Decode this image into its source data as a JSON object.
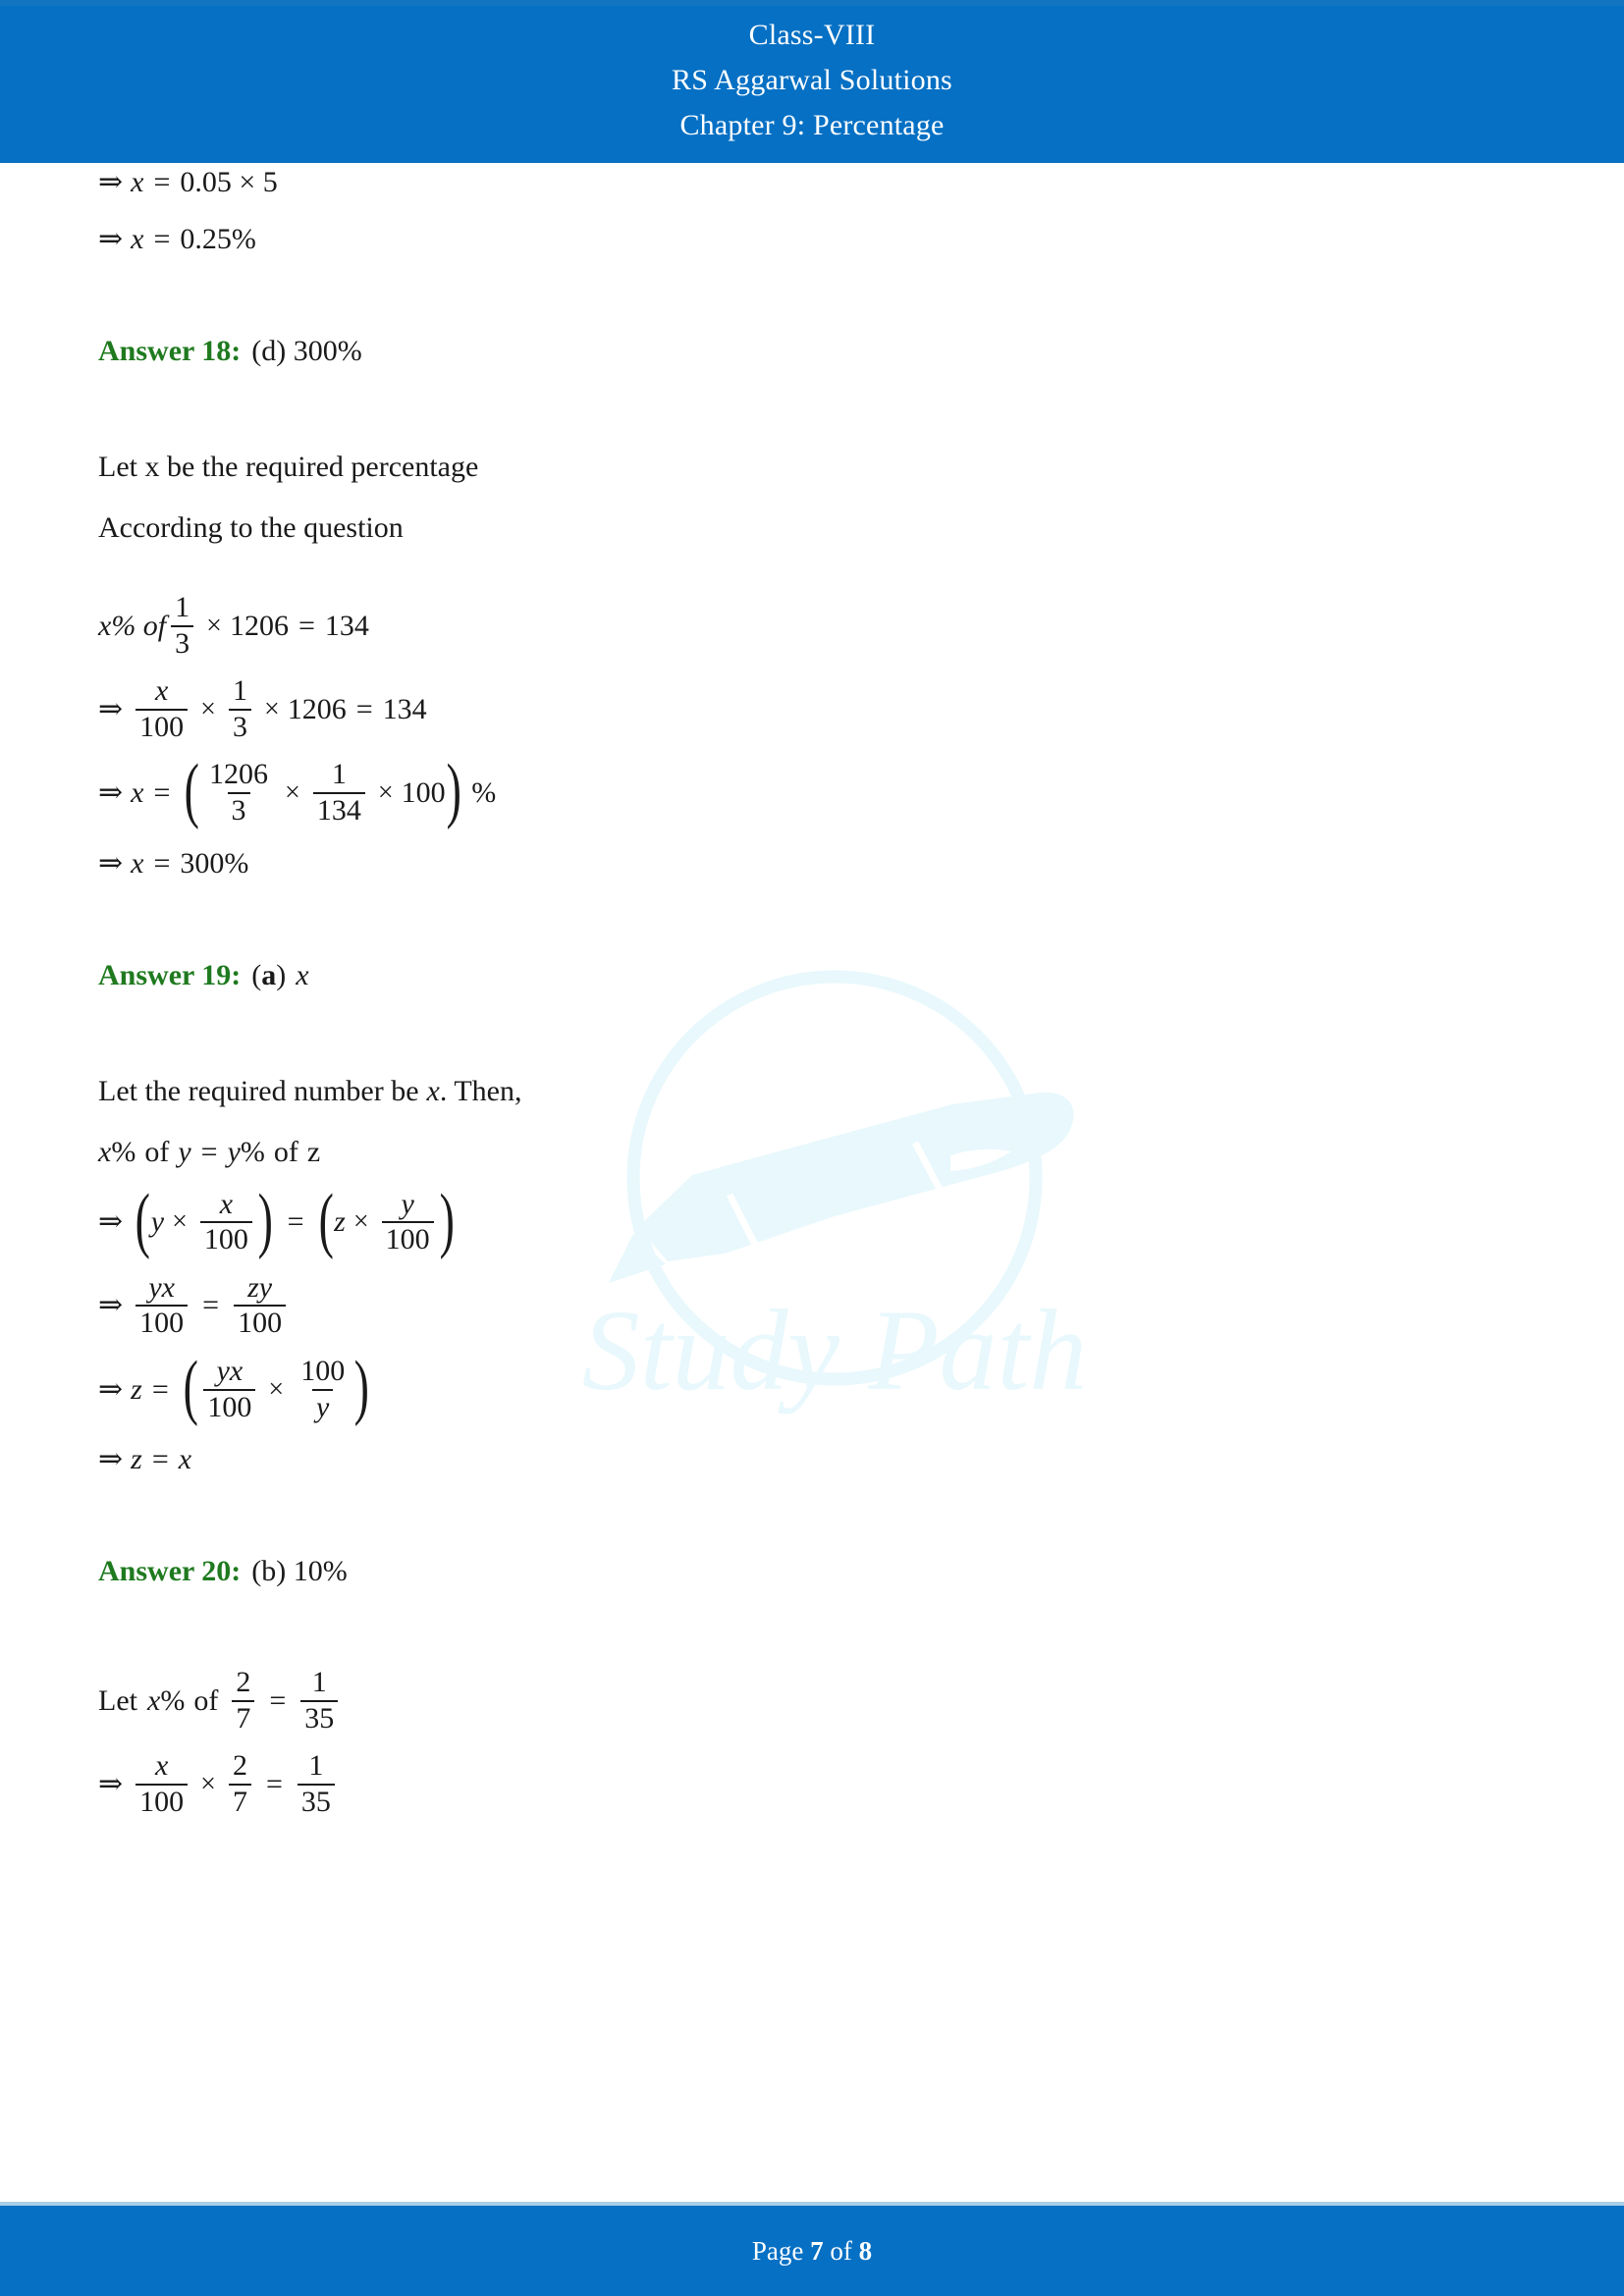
{
  "colors": {
    "header_blue": "#0570c4",
    "footer_blue": "#0570c4",
    "answer_green": "#1f7a1f",
    "text_black": "#1a1a1a",
    "watermark_cyan": "#e6f8fc"
  },
  "header": {
    "line1": "Class-VIII",
    "line2": "RS Aggarwal Solutions",
    "line3": "Chapter 9: Percentage"
  },
  "footer": {
    "prefix": "Page",
    "current_page": "7",
    "middle": "of",
    "total_pages": "8"
  },
  "watermark": {
    "text": "Study Path",
    "icon": "fountain-pen-nib-icon"
  },
  "content": {
    "carryover": {
      "eq1": {
        "arrow": "⇒",
        "lhs": "x",
        "eq": "=",
        "rhs": "0.05 × 5"
      },
      "eq2": {
        "arrow": "⇒",
        "lhs": "x",
        "eq": "=",
        "rhs": "0.25%"
      }
    },
    "answer18": {
      "label": "Answer 18:",
      "value": "(d) 300%",
      "text1": "Let x be the required percentage",
      "text2": "According to the question",
      "eq_setup": {
        "lead": "x% of",
        "frac_num": "1",
        "frac_den": "3",
        "times": "×",
        "value": "1206",
        "eq": "=",
        "result": "134"
      },
      "eq_step1": {
        "arrow": "⇒",
        "f1_num": "x",
        "f1_den": "100",
        "times1": "×",
        "f2_num": "1",
        "f2_den": "3",
        "times2": "×",
        "value": "1206",
        "eq": "=",
        "result": "134"
      },
      "eq_step2": {
        "arrow": "⇒",
        "lhs": "x",
        "eq": "=",
        "f1_num": "1206",
        "f1_den": "3",
        "times1": "×",
        "f2_num": "1",
        "f2_den": "134",
        "times2": "×",
        "value": "100",
        "pct": "%"
      },
      "eq_final": {
        "arrow": "⇒",
        "lhs": "x",
        "eq": "=",
        "rhs": "300%"
      }
    },
    "answer19": {
      "label": "Answer 19:",
      "option": "a",
      "value_prefix": "(",
      "value_suffix": ")",
      "value_var": "x",
      "text1_a": "Let the required number be",
      "text1_var": "x",
      "text1_b": ". Then,",
      "eq_setup": {
        "v1": "x",
        "pct1": "%",
        "of1": "of",
        "v2": "y",
        "eq": "=",
        "v3": "y",
        "pct2": "%",
        "of2": "of",
        "v4": "z"
      },
      "eq_step1": {
        "arrow": "⇒",
        "lv": "y",
        "ltimes": "×",
        "lf_num": "x",
        "lf_den": "100",
        "eq": "=",
        "rv": "z",
        "rtimes": "×",
        "rf_num": "y",
        "rf_den": "100"
      },
      "eq_step2": {
        "arrow": "⇒",
        "f1_num": "yx",
        "f1_den": "100",
        "eq": "=",
        "f2_num": "zy",
        "f2_den": "100"
      },
      "eq_step3": {
        "arrow": "⇒",
        "lhs": "z",
        "eq": "=",
        "f1_num": "yx",
        "f1_den": "100",
        "times": "×",
        "f2_num": "100",
        "f2_den": "y"
      },
      "eq_final": {
        "arrow": "⇒",
        "lhs": "z",
        "eq": "=",
        "rhs": "x"
      }
    },
    "answer20": {
      "label": "Answer 20:",
      "value": "(b) 10%",
      "eq_setup": {
        "lead": "Let",
        "var": "x",
        "pct": "%",
        "of": "of",
        "f1_num": "2",
        "f1_den": "7",
        "eq": "=",
        "f2_num": "1",
        "f2_den": "35"
      },
      "eq_step1": {
        "arrow": "⇒",
        "f1_num": "x",
        "f1_den": "100",
        "times": "×",
        "f2_num": "2",
        "f2_den": "7",
        "eq": "=",
        "f3_num": "1",
        "f3_den": "35"
      }
    }
  }
}
